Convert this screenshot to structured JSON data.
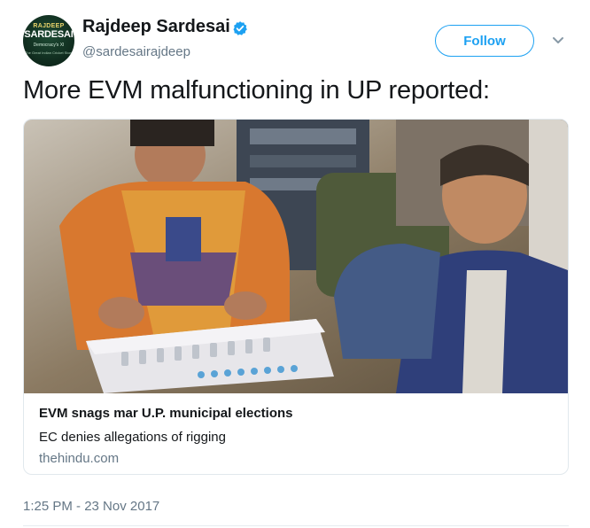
{
  "author": {
    "name": "Rajdeep Sardesai",
    "handle": "@sardesairajdeep",
    "avatar_text": [
      "RAJDEEP",
      "SARDESAI",
      "Democracy's XI",
      "The Great Indian Cricket Story"
    ],
    "verified_icon": "verified-badge-icon"
  },
  "actions": {
    "follow_label": "Follow",
    "menu_icon": "chevron-down-icon"
  },
  "tweet": {
    "text": "More EVM malfunctioning in UP reported:",
    "timestamp": "1:25 PM - 23 Nov 2017"
  },
  "card": {
    "title": "EVM snags mar U.P. municipal elections",
    "description": "EC denies allegations of rigging",
    "domain": "thehindu.com"
  },
  "colors": {
    "accent": "#1da1f2",
    "text_primary": "#14171a",
    "text_secondary": "#657786",
    "border": "#e1e8ed"
  }
}
